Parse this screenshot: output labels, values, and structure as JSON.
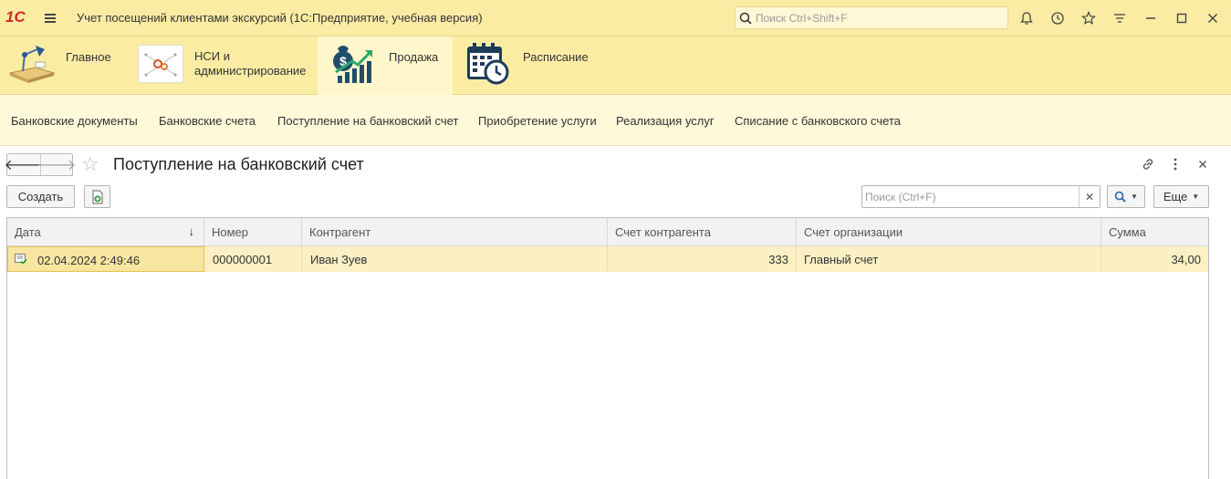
{
  "app": {
    "logo": "1С",
    "title": "Учет посещений клиентами экскурсий  (1С:Предприятие, учебная версия)",
    "search_placeholder": "Поиск Ctrl+Shift+F"
  },
  "sections": [
    {
      "label": "Главное"
    },
    {
      "label_line1": "НСИ и",
      "label_line2": "администрирование"
    },
    {
      "label": "Продажа",
      "active": true
    },
    {
      "label": "Расписание"
    }
  ],
  "subnav": [
    "Банковские документы",
    "Банковские счета",
    "Поступление на банковский счет",
    "Приобретение услуги",
    "Реализация услуг",
    "Списание с банковского счета"
  ],
  "form": {
    "title": "Поступление на банковский счет",
    "create_label": "Создать",
    "search_placeholder": "Поиск (Ctrl+F)",
    "more_label": "Еще"
  },
  "table": {
    "columns": [
      "Дата",
      "Номер",
      "Контрагент",
      "Счет контрагента",
      "Счет организации",
      "Сумма"
    ],
    "sort_indicator": "↓",
    "rows": [
      {
        "date": "02.04.2024 2:49:46",
        "number": "000000001",
        "counterparty": "Иван Зуев",
        "counterparty_account": "333",
        "org_account": "Главный счет",
        "amount": "34,00"
      }
    ]
  },
  "colors": {
    "accent": "#fbeca4",
    "active_section": "#fff6cc",
    "selected_row": "#fbf0c4"
  }
}
